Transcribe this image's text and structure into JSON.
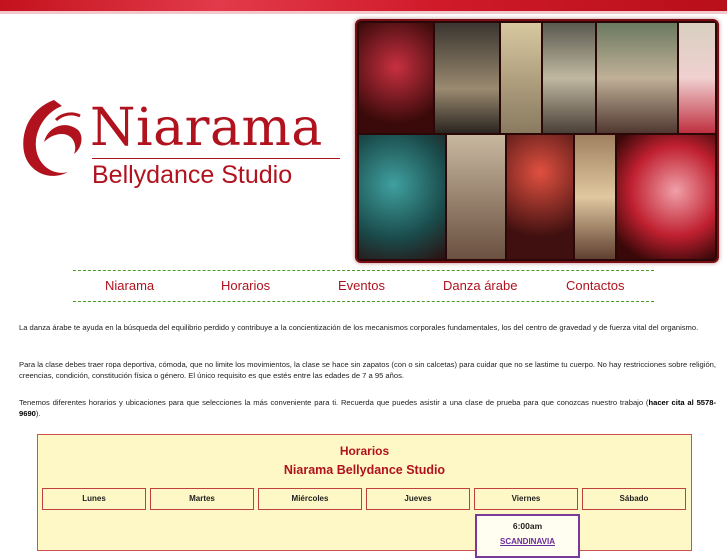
{
  "brand": {
    "name": "Niarama",
    "tagline": "Bellydance Studio",
    "color": "#b0121e"
  },
  "nav": [
    {
      "label": "Niarama"
    },
    {
      "label": "Horarios"
    },
    {
      "label": "Eventos"
    },
    {
      "label": "Danza árabe"
    },
    {
      "label": "Contactos"
    }
  ],
  "intro": {
    "p1": "La danza árabe te ayuda en la búsqueda del equilibrio perdido y contribuye a la concientización de los mecanismos corporales fundamentales, los del centro de gravedad y de fuerza vital del organismo.",
    "p2": "Para la clase debes traer ropa deportiva, cómoda, que no limite los movimientos, la clase se hace sin zapatos (con o sin calcetas) para cuidar que no se lastime tu cuerpo. No hay restricciones sobre religión, creencias, condición, constitución física o género. El único requisito es que estés entre las edades de 7 a 95 años.",
    "p3_text": "Tenemos diferentes horarios y ubicaciones para que selecciones la más conveniente para ti. Recuerda que puedes asistir a una clase de prueba para que conozcas nuestro trabajo (",
    "p3_bold": "hacer cita al 5578-9690",
    "p3_end": ")."
  },
  "schedule": {
    "title": "Horarios",
    "subtitle": "Niarama Bellydance Studio",
    "days": [
      "Lunes",
      "Martes",
      "Miércoles",
      "Jueves",
      "Viernes",
      "Sábado"
    ],
    "slot": {
      "time": "6:00am",
      "location": "SCANDINAVIA"
    }
  }
}
